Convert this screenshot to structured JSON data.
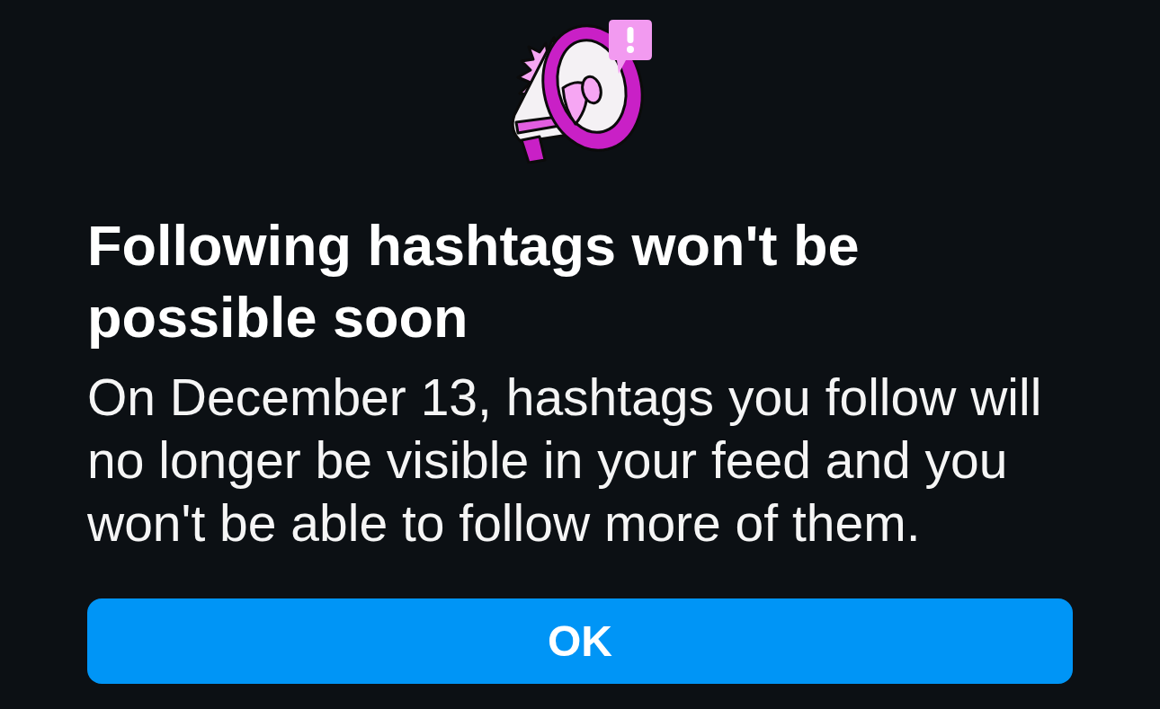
{
  "dialog": {
    "title": "Following hashtags won't be possible soon",
    "message": "On December 13, hashtags you follow will no longer be visible in your feed and you won't be able to follow more of them.",
    "buttons": [
      {
        "label": "OK",
        "kind": "primary"
      }
    ]
  }
}
